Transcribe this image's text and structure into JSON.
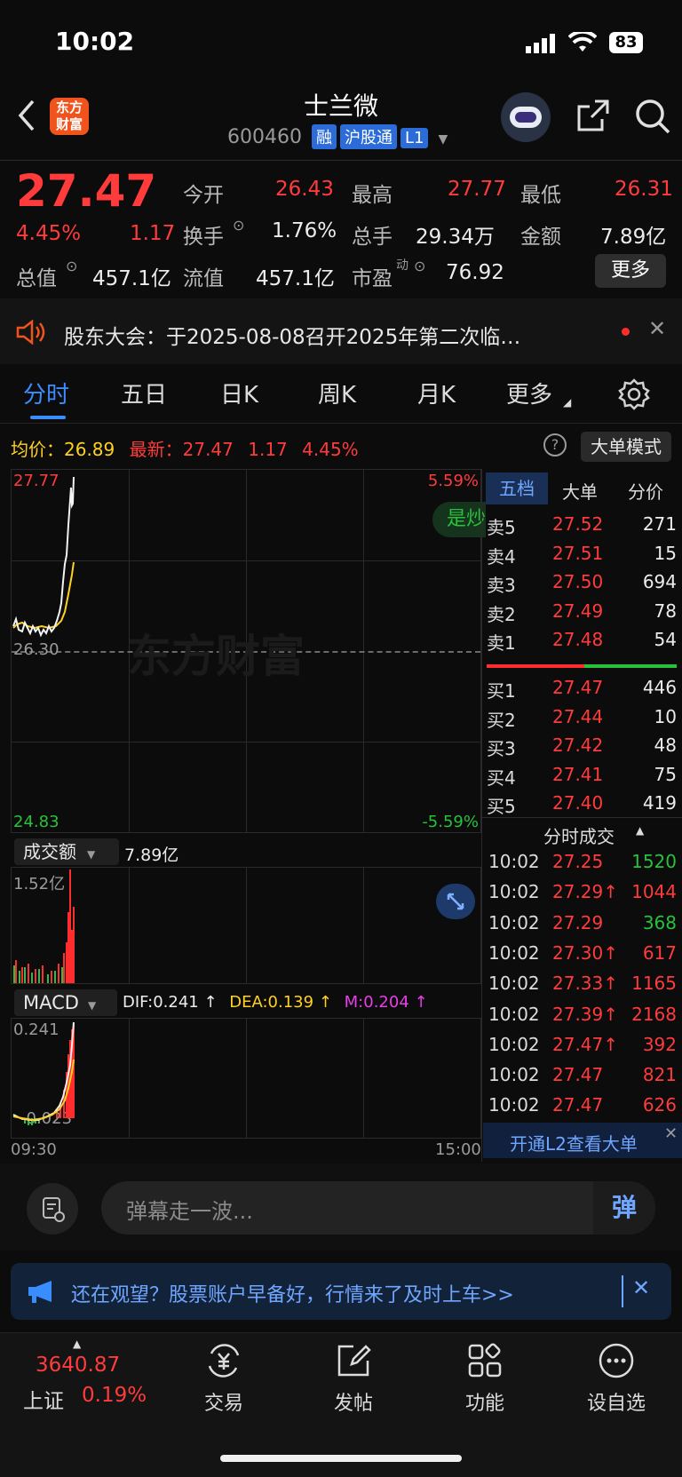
{
  "status": {
    "time": "10:02",
    "battery": "83"
  },
  "header": {
    "logo_text": "东方\n财富",
    "name": "士兰微",
    "code": "600460",
    "tags": [
      "融",
      "沪股通",
      "L1"
    ]
  },
  "quote": {
    "price": "27.47",
    "change_pct": "4.45%",
    "change": "1.17",
    "open_label": "今开",
    "open": "26.43",
    "high_label": "最高",
    "high": "27.77",
    "low_label": "最低",
    "low": "26.31",
    "turnover_label": "换手",
    "turnover": "1.76%",
    "volume_label": "总手",
    "volume": "29.34万",
    "amount_label": "金额",
    "amount": "7.89亿",
    "mktcap_label": "总值",
    "mktcap": "457.1亿",
    "float_label": "流值",
    "float": "457.1亿",
    "pe_label": "市盈",
    "pe_sup": "动",
    "pe": "76.92",
    "more": "更多"
  },
  "notice": {
    "text": "股东大会：于2025-08-08召开2025年第二次临…"
  },
  "tabs": [
    "分时",
    "五日",
    "日K",
    "周K",
    "月K",
    "更多"
  ],
  "chart_header": {
    "avg_label": "均价：",
    "avg": "26.89",
    "latest_label": "最新：",
    "latest": "27.47",
    "chg": "1.17",
    "pct": "4.45%",
    "mode_button": "大单模式"
  },
  "chart_labels": {
    "top_price": "27.77",
    "top_pct": "5.59%",
    "mid_price": "26.30",
    "bottom_price": "24.83",
    "bottom_pct": "-5.59%",
    "watermark": "东方财富",
    "bubble": "是炒",
    "start_time": "09:30",
    "end_time": "15:00"
  },
  "volume_panel": {
    "label": "成交额",
    "value": "7.89亿",
    "max": "1.52亿"
  },
  "macd_panel": {
    "label": "MACD",
    "dif": "DIF:0.241 ↑",
    "dea": "DEA:0.139 ↑",
    "m": "M:0.204 ↑",
    "max": "0.241",
    "min": "-0.023"
  },
  "orderbook": {
    "tabs": [
      "五档",
      "大单",
      "分价"
    ],
    "asks": [
      {
        "label": "卖5",
        "price": "27.52",
        "vol": "271"
      },
      {
        "label": "卖4",
        "price": "27.51",
        "vol": "15"
      },
      {
        "label": "卖3",
        "price": "27.50",
        "vol": "694"
      },
      {
        "label": "卖2",
        "price": "27.49",
        "vol": "78"
      },
      {
        "label": "卖1",
        "price": "27.48",
        "vol": "54"
      }
    ],
    "bids": [
      {
        "label": "买1",
        "price": "27.47",
        "vol": "446"
      },
      {
        "label": "买2",
        "price": "27.44",
        "vol": "10"
      },
      {
        "label": "买3",
        "price": "27.42",
        "vol": "48"
      },
      {
        "label": "买4",
        "price": "27.41",
        "vol": "75"
      },
      {
        "label": "买5",
        "price": "27.40",
        "vol": "419"
      }
    ]
  },
  "trades": {
    "title": "分时成交",
    "rows": [
      {
        "time": "10:02",
        "price": "27.25",
        "vol": "1520",
        "color": "green"
      },
      {
        "time": "10:02",
        "price": "27.29↑",
        "vol": "1044",
        "color": "red"
      },
      {
        "time": "10:02",
        "price": "27.29",
        "vol": "368",
        "color": "green"
      },
      {
        "time": "10:02",
        "price": "27.30↑",
        "vol": "617",
        "color": "red"
      },
      {
        "time": "10:02",
        "price": "27.33↑",
        "vol": "1165",
        "color": "red"
      },
      {
        "time": "10:02",
        "price": "27.39↑",
        "vol": "2168",
        "color": "red"
      },
      {
        "time": "10:02",
        "price": "27.47↑",
        "vol": "392",
        "color": "red"
      },
      {
        "time": "10:02",
        "price": "27.47",
        "vol": "821",
        "color": "red"
      },
      {
        "time": "10:02",
        "price": "27.47",
        "vol": "626",
        "color": "red"
      }
    ],
    "l2_banner": "开通L2查看大单"
  },
  "comment": {
    "placeholder": "弹幕走一波...",
    "send_label": "弹"
  },
  "ad": {
    "text": "还在观望？股票账户早备好，行情来了及时上车>>"
  },
  "bottom_nav": {
    "index_value": "3640.87",
    "index_name": "上证",
    "index_pct": "0.19%",
    "items": [
      "交易",
      "发帖",
      "功能",
      "设自选"
    ]
  }
}
